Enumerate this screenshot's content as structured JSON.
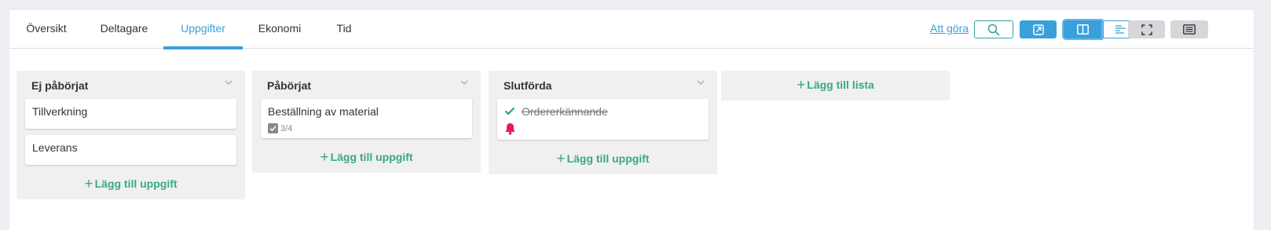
{
  "tabs": [
    {
      "label": "Översikt",
      "active": false
    },
    {
      "label": "Deltagare",
      "active": false
    },
    {
      "label": "Uppgifter",
      "active": true
    },
    {
      "label": "Ekonomi",
      "active": false
    },
    {
      "label": "Tid",
      "active": false
    }
  ],
  "toolbar": {
    "todo_link": "Att göra",
    "icons": [
      "search-icon",
      "external-link-icon",
      "board-view-icon",
      "timeline-view-icon",
      "fullscreen-icon",
      "list-view-icon"
    ]
  },
  "board": {
    "columns": [
      {
        "title": "Ej påbörjat",
        "cards": [
          {
            "title": "Tillverkning"
          },
          {
            "title": "Leverans"
          }
        ],
        "add_label": "Lägg till uppgift"
      },
      {
        "title": "Påbörjat",
        "cards": [
          {
            "title": "Beställning av material",
            "checklist": "3/4"
          }
        ],
        "add_label": "Lägg till uppgift"
      },
      {
        "title": "Slutförda",
        "cards": [
          {
            "title": "Ordererkännande",
            "completed": true,
            "reminder": true
          }
        ],
        "add_label": "Lägg till uppgift"
      }
    ],
    "add_list_label": "Lägg till lista"
  },
  "colors": {
    "accent": "#3aa0dc",
    "add_green": "#3aaa7e",
    "done_check": "#3aaa7e",
    "bell": "#e8195c"
  }
}
